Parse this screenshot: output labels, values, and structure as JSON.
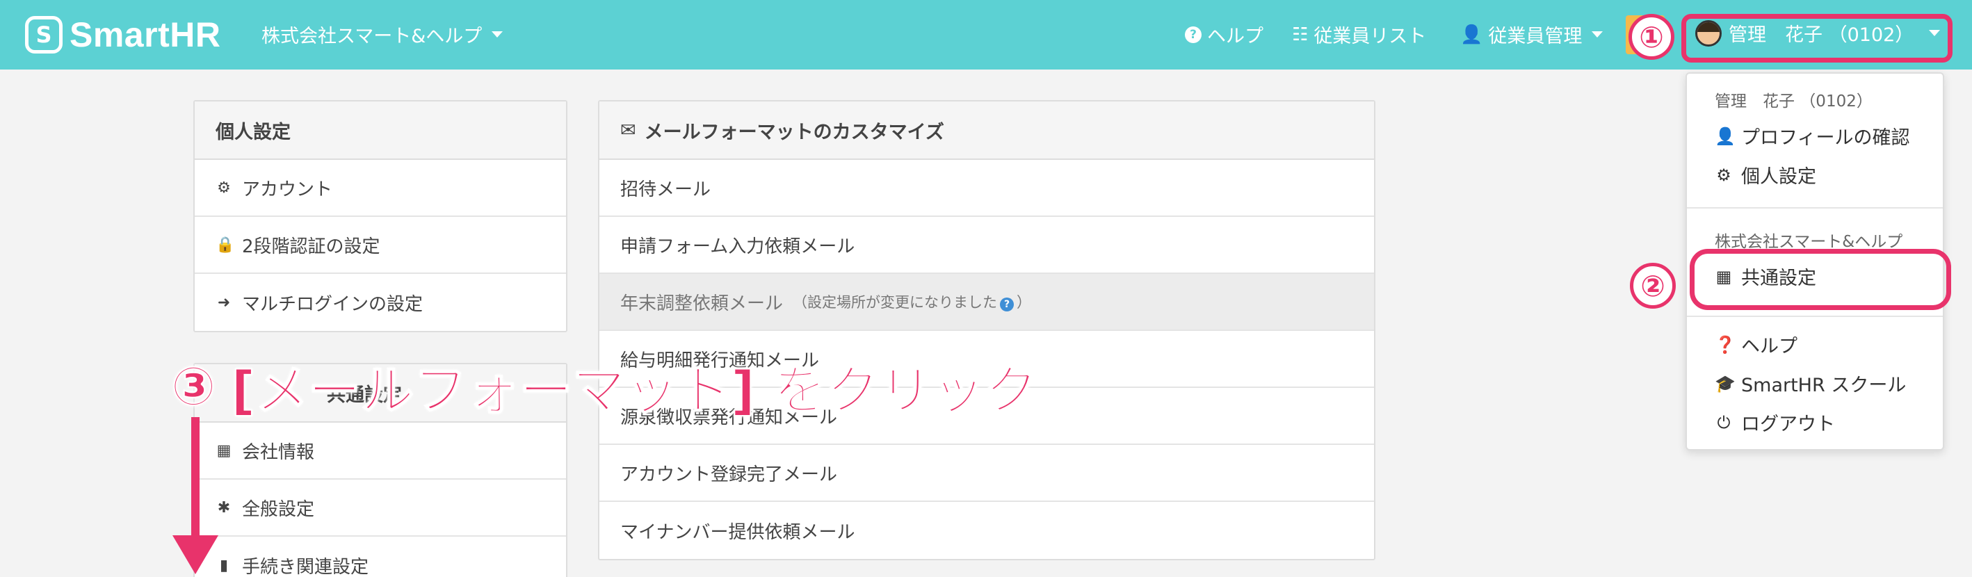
{
  "header": {
    "logo_text": "SmartHR",
    "logo_mark": "S",
    "company": "株式会社スマート&ヘルプ",
    "nav": [
      {
        "label": "ヘルプ",
        "icon": "question-circle-icon"
      },
      {
        "label": "従業員リスト",
        "icon": "list-icon"
      },
      {
        "label": "従業員管理",
        "icon": "user-icon"
      }
    ],
    "user_name": "管理　花子 （0102）"
  },
  "personal_settings": {
    "title": "個人設定",
    "items": [
      {
        "label": "アカウント",
        "icon": "gear-icon"
      },
      {
        "label": "2段階認証の設定",
        "icon": "lock-icon"
      },
      {
        "label": "マルチログインの設定",
        "icon": "sign-in-icon"
      }
    ]
  },
  "common_settings": {
    "title_partial": "共通設定",
    "items": [
      {
        "label": "会社情報",
        "icon": "building-icon"
      },
      {
        "label": "全般設定",
        "icon": "asterisk-icon"
      },
      {
        "label": "手続き関連設定",
        "icon": "book-icon"
      }
    ]
  },
  "mail_format": {
    "title": "メールフォーマットのカスタマイズ",
    "items": [
      {
        "label": "招待メール"
      },
      {
        "label": "申請フォーム入力依頼メール"
      },
      {
        "label": "年末調整依頼メール",
        "note_open": "（設定場所が変更になりました",
        "note_close": "）",
        "disabled": true
      },
      {
        "label": "給与明細発行通知メール"
      },
      {
        "label": "源泉徴収票発行通知メール"
      },
      {
        "label": "アカウント登録完了メール"
      },
      {
        "label": "マイナンバー提供依頼メール"
      }
    ]
  },
  "dropdown": {
    "user_header": "管理　花子 （0102）",
    "profile": "プロフィールの確認",
    "personal": "個人設定",
    "company_header": "株式会社スマート&ヘルプ",
    "common": "共通設定",
    "help": "ヘルプ",
    "school": "SmartHR スクール",
    "logout": "ログアウト"
  },
  "annotations": {
    "step1": "①",
    "step2": "②",
    "step3_num": "③",
    "step3_text": "[メールフォーマット] をクリック",
    "accent_color": "#e8336b"
  },
  "colors": {
    "header_bg": "#5cd1d3",
    "accent": "#e8336b"
  }
}
